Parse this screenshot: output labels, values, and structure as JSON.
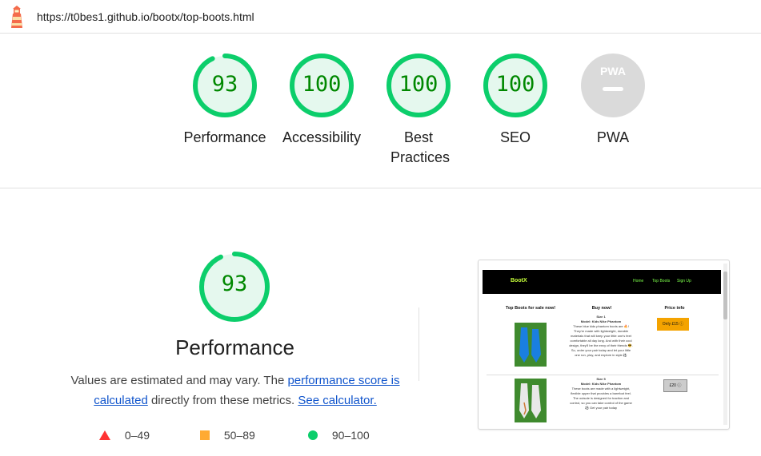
{
  "header": {
    "url": "https://t0bes1.github.io/bootx/top-boots.html"
  },
  "gauges": [
    {
      "score": "93",
      "label": "Performance",
      "value": 0.93
    },
    {
      "score": "100",
      "label": "Accessibility",
      "value": 1.0
    },
    {
      "score": "100",
      "label": "Best Practices",
      "value": 1.0
    },
    {
      "score": "100",
      "label": "SEO",
      "value": 1.0
    },
    {
      "score": "",
      "label": "PWA",
      "badge": "PWA"
    }
  ],
  "performance": {
    "score": "93",
    "value": 0.93,
    "title": "Performance",
    "desc_prefix": "Values are estimated and may vary. The ",
    "desc_link": "performance score is calculated",
    "desc_middle": " directly from these metrics. ",
    "desc_calc_link": "See calculator.",
    "legend": [
      {
        "range": "0–49",
        "color": "#ff3333",
        "icon": "triangle-icon"
      },
      {
        "range": "50–89",
        "color": "#ffaa33",
        "icon": "square-icon"
      },
      {
        "range": "90–100",
        "color": "#0cce6b",
        "icon": "circle-icon"
      }
    ]
  },
  "colors": {
    "pass": "#0cce6b",
    "pass_fill": "#e5f8ee",
    "pass_text": "#008800",
    "pwa_gray": "#dadada"
  },
  "screenshot": {
    "brand": "BootX",
    "nav_links": [
      "Home",
      "Top Boots",
      "Sign Up"
    ],
    "col1": "Top Boots for sale now!",
    "col2": "Buy now!",
    "col3": "Price info",
    "item1_size": "Size 1",
    "item1_model": "Model: Kids Nike Phantom",
    "item1_desc": "These blue kids phantom boots are 🔥! They're made with lightweight, durable materials that will keep your little one's feet comfortable all day long. And with their cool design, they'll be the envy of their friends 😎. So, order your pair today and let your little one run, play, and explore in style ⚽",
    "item1_price": "Only £15 ⓘ",
    "item2_size": "Size 5",
    "item2_model": "Model: Kids Nike Phantom",
    "item2_desc": "These boots are made with a lightweight, flexible upper that provides a barefoot feel. The outsole is designed for traction and control, so you can take control of the game ⚽ Get your pair today",
    "item2_price": "£20 ⓘ"
  }
}
